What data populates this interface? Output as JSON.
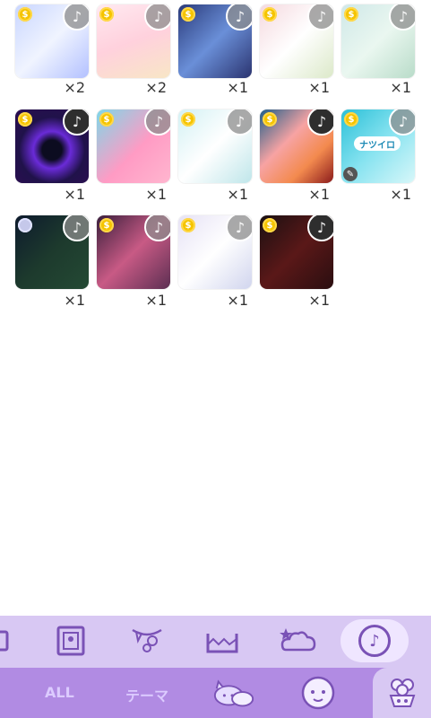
{
  "items": [
    {
      "qty": "×2",
      "coin": "$",
      "note": "♪",
      "coin_style": "gold",
      "note_style": "grey"
    },
    {
      "qty": "×2",
      "coin": "$",
      "note": "♪",
      "coin_style": "gold",
      "note_style": "grey"
    },
    {
      "qty": "×1",
      "coin": "$",
      "note": "♪",
      "coin_style": "gold",
      "note_style": "grey"
    },
    {
      "qty": "×1",
      "coin": "$",
      "note": "♪",
      "coin_style": "gold",
      "note_style": "grey"
    },
    {
      "qty": "×1",
      "coin": "$",
      "note": "♪",
      "coin_style": "gold",
      "note_style": "grey"
    },
    {
      "qty": "×1",
      "coin": "$",
      "note": "♪",
      "coin_style": "gold",
      "note_style": "dark"
    },
    {
      "qty": "×1",
      "coin": "$",
      "note": "♪",
      "coin_style": "gold",
      "note_style": "grey"
    },
    {
      "qty": "×1",
      "coin": "$",
      "note": "♪",
      "coin_style": "gold",
      "note_style": "grey"
    },
    {
      "qty": "×1",
      "coin": "$",
      "note": "♪",
      "coin_style": "gold",
      "note_style": "dark"
    },
    {
      "qty": "×1",
      "coin": "$",
      "note": "♪",
      "coin_style": "gold",
      "note_style": "grey",
      "pill": "ナツイロ"
    },
    {
      "qty": "×1",
      "coin": "",
      "note": "♪",
      "coin_style": "silver",
      "note_style": "grey"
    },
    {
      "qty": "×1",
      "coin": "$",
      "note": "♪",
      "coin_style": "gold",
      "note_style": "grey"
    },
    {
      "qty": "×1",
      "coin": "$",
      "note": "♪",
      "coin_style": "gold",
      "note_style": "grey"
    },
    {
      "qty": "×1",
      "coin": "$",
      "note": "♪",
      "coin_style": "gold",
      "note_style": "dark"
    }
  ],
  "toolbar": {
    "music_label": "♪"
  },
  "tabs": {
    "all_label": "ALL",
    "theme_label": "テーマ"
  }
}
